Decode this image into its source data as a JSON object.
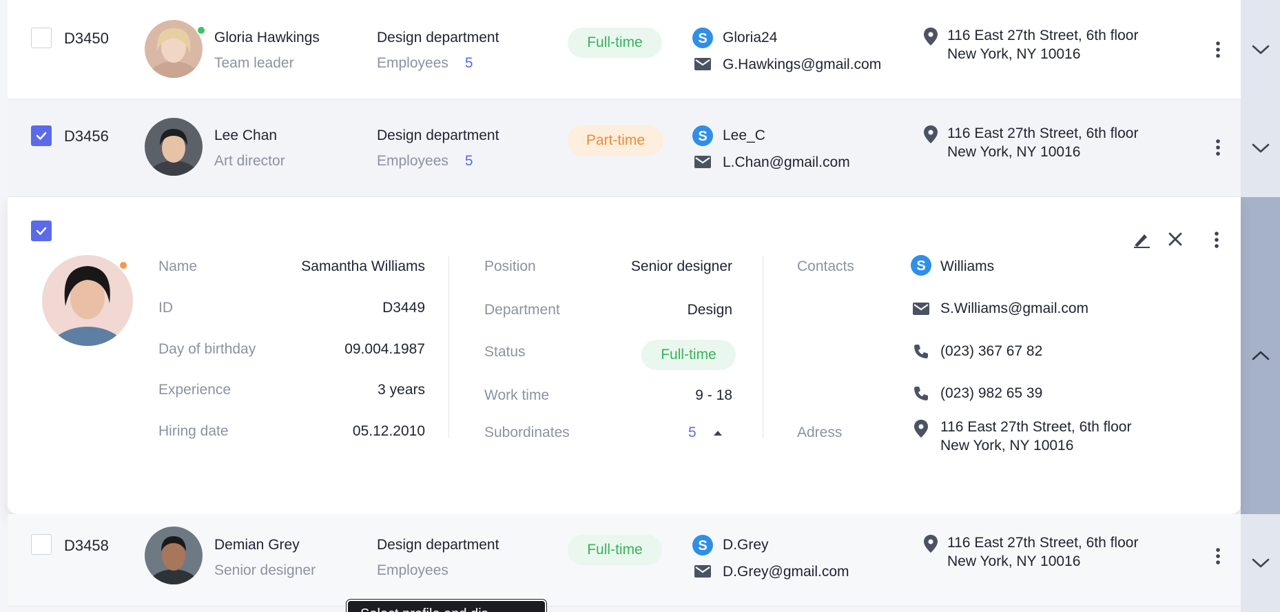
{
  "rows": [
    {
      "id": "D3450",
      "name": "Gloria Hawkings",
      "role": "Team leader",
      "department": "Design department",
      "employees_label": "Employees",
      "employees_count": "5",
      "status": "Full-time",
      "skype": "Gloria24",
      "email": "G.Hawkings@gmail.com",
      "address_line1": "116 East 27th Street, 6th floor",
      "address_line2": "New York, NY 10016",
      "checked": false,
      "online": "green"
    },
    {
      "id": "D3456",
      "name": "Lee Chan",
      "role": "Art director",
      "department": "Design department",
      "employees_label": "Employees",
      "employees_count": "5",
      "status": "Part-time",
      "skype": "Lee_C",
      "email": "L.Chan@gmail.com",
      "address_line1": "116 East 27th Street, 6th floor",
      "address_line2": "New York, NY 10016",
      "checked": true
    },
    {
      "id": "D3458",
      "name": "Demian Grey",
      "role": "Senior designer",
      "department": "Design department",
      "employees_label": "Employees",
      "employees_count": "",
      "status": "Full-time",
      "skype": "D.Grey",
      "email": "D.Grey@gmail.com",
      "address_line1": "116 East 27th Street, 6th floor",
      "address_line2": "New York, NY 10016",
      "checked": false
    }
  ],
  "detail": {
    "checked": true,
    "name_label": "Name",
    "name_value": "Samantha Williams",
    "id_label": "ID",
    "id_value": "D3449",
    "birthday_label": "Day of birthday",
    "birthday_value": "09.004.1987",
    "experience_label": "Experience",
    "experience_value": "3 years",
    "hiring_label": "Hiring date",
    "hiring_value": "05.12.2010",
    "position_label": "Position",
    "position_value": "Senior designer",
    "department_label": "Department",
    "department_value": "Design",
    "status_label": "Status",
    "status_value": "Full-time",
    "worktime_label": "Work time",
    "worktime_value": "9 - 18",
    "subordinates_label": "Subordinates",
    "subordinates_value": "5",
    "contacts_label": "Contacts",
    "skype": "Williams",
    "email": "S.Williams@gmail.com",
    "phone1": "(023) 367 67 82",
    "phone2": "(023) 982 65 39",
    "address_label": "Adress",
    "address_line1": "116 East 27th Street, 6th floor",
    "address_line2": "New York, NY 10016"
  },
  "tooltip": {
    "text": "Select profile and dis"
  },
  "colors": {
    "accent": "#5a6ae8",
    "full_time_text": "#37b35a",
    "full_time_bg": "#e9f7ee",
    "part_time_text": "#f08a3a",
    "part_time_bg": "#fdeedd",
    "skype_blue": "#2f8fe8",
    "online_green": "#3ec45c",
    "away_orange": "#f39a4a"
  },
  "icons": [
    "checkbox-icon",
    "skype-icon",
    "mail-icon",
    "location-pin-icon",
    "more-vertical-icon",
    "chevron-down-icon",
    "chevron-up-icon",
    "edit-icon",
    "close-icon",
    "phone-icon",
    "caret-up-icon"
  ]
}
